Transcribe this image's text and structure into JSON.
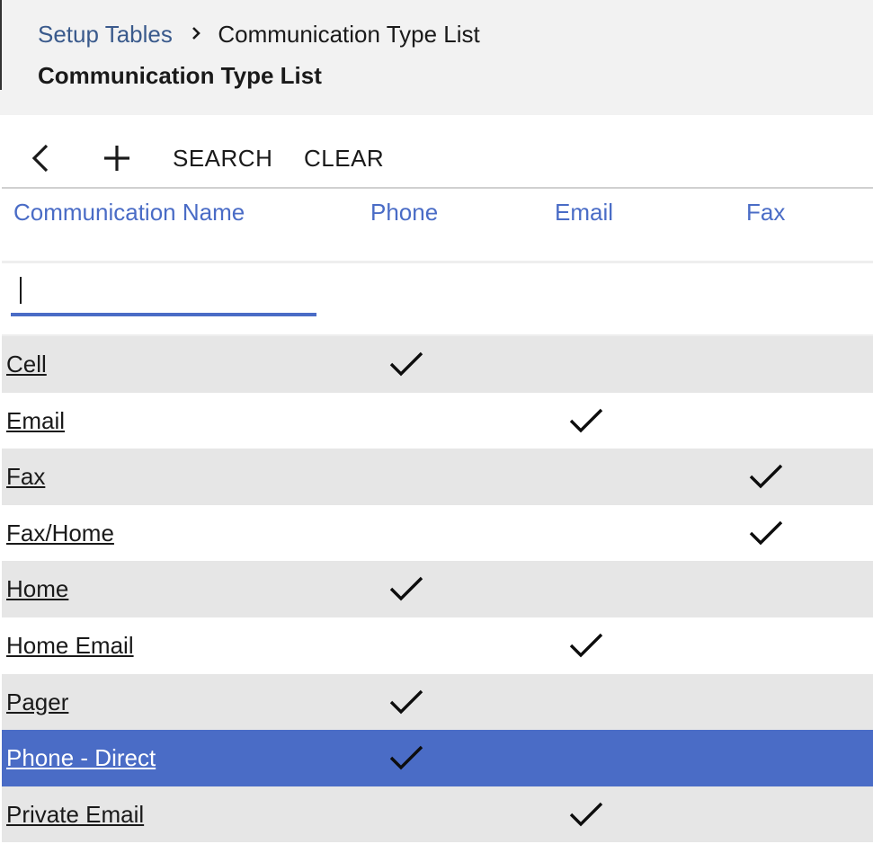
{
  "breadcrumb": {
    "parent": "Setup Tables",
    "current": "Communication Type List"
  },
  "page_title": "Communication Type List",
  "toolbar": {
    "back_icon": "chevron-left-icon",
    "add_icon": "plus-icon",
    "search_label": "SEARCH",
    "clear_label": "CLEAR"
  },
  "columns": [
    "Communication Name",
    "Phone",
    "Email",
    "Fax"
  ],
  "filter": {
    "value": "",
    "placeholder": ""
  },
  "rows": [
    {
      "name": "Cell",
      "phone": true,
      "email": false,
      "fax": false
    },
    {
      "name": "Email",
      "phone": false,
      "email": true,
      "fax": false
    },
    {
      "name": "Fax",
      "phone": false,
      "email": false,
      "fax": true
    },
    {
      "name": "Fax/Home",
      "phone": false,
      "email": false,
      "fax": true
    },
    {
      "name": "Home",
      "phone": true,
      "email": false,
      "fax": false
    },
    {
      "name": "Home Email",
      "phone": false,
      "email": true,
      "fax": false
    },
    {
      "name": "Pager",
      "phone": true,
      "email": false,
      "fax": false
    },
    {
      "name": "Phone - Direct",
      "phone": true,
      "email": false,
      "fax": false,
      "selected": true
    },
    {
      "name": "Private Email",
      "phone": false,
      "email": true,
      "fax": false
    }
  ],
  "colors": {
    "accent": "#4a6cc6",
    "row_stripe": "#e6e6e6",
    "header_bg": "#f2f2f2",
    "breadcrumb_link": "#3a5a8c"
  }
}
